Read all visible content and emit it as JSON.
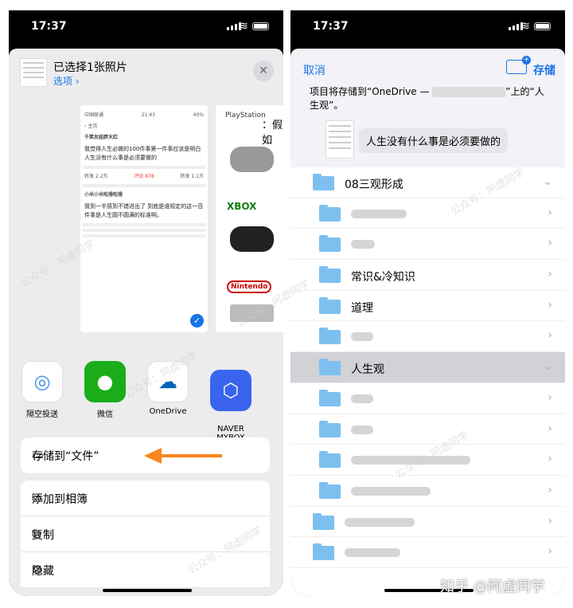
{
  "status": {
    "time": "17:37"
  },
  "share_sheet": {
    "title": "已选择1张照片",
    "options": "选项",
    "close": "✕",
    "preview": {
      "carrier": "中国联通",
      "time": "21:43",
      "battery": "40%",
      "back": "主页",
      "author": "千笑女娃胖大红",
      "post": "我觉得人生必做的100件事第一件事应该是明白人生没有什么事是必须要做的",
      "tabs": [
        "转发 2.2万",
        "评论 878",
        "转发 1.1万"
      ],
      "comment_user": "小米小米啦撸啦撸",
      "comment_text": "我到一半感到不错进出了 到底是谁规定的这一百件事是人生圆不圆满的标准啊。"
    },
    "preview2": {
      "title": "：假如",
      "logos": [
        "PlayStation",
        "XBOX",
        "Nintendo"
      ]
    },
    "apps": [
      {
        "label": "隔空投送",
        "icon": "airdrop-icon",
        "color": "#3a8ef0"
      },
      {
        "label": "微信",
        "icon": "wechat-icon",
        "color": "#1aad19"
      },
      {
        "label": "OneDrive",
        "icon": "onedrive-icon",
        "color": "#0364b8"
      },
      {
        "label": "NAVER\nMYBOX",
        "icon": "naver-mybox-icon",
        "color": "#3a64f0"
      }
    ],
    "actions": [
      {
        "label": "存储到“文件”",
        "icon": "folder-icon"
      },
      {
        "label": "添加到相簿",
        "icon": "add-album-icon"
      },
      {
        "label": "复制",
        "icon": "copy-icon"
      },
      {
        "label": "隐藏",
        "icon": "hide-eye-icon"
      }
    ]
  },
  "files": {
    "cancel": "取消",
    "save": "存储",
    "dest_prefix": "项目将存储到“OneDrive —",
    "dest_suffix": "”上的“人生观”。",
    "file_name": "人生没有什么事是必须要做的",
    "folders": [
      {
        "label": "08三观形成",
        "indent": 0,
        "expanded": true
      },
      {
        "label": "",
        "indent": 1,
        "blur": 70
      },
      {
        "label": "",
        "indent": 1,
        "blur": 30
      },
      {
        "label": "常识&冷知识",
        "indent": 1
      },
      {
        "label": "道理",
        "indent": 1
      },
      {
        "label": "",
        "indent": 1,
        "blur": 28
      },
      {
        "label": "人生观",
        "indent": 1,
        "expanded": true,
        "selected": true
      },
      {
        "label": "",
        "indent": 1,
        "blur": 28
      },
      {
        "label": "",
        "indent": 1,
        "blur": 28
      },
      {
        "label": "",
        "indent": 1,
        "blur": 150
      },
      {
        "label": "",
        "indent": 1,
        "blur": 100
      },
      {
        "label": "",
        "indent": 0,
        "blur": 88
      },
      {
        "label": "",
        "indent": 0,
        "blur": 70
      }
    ]
  },
  "watermark": "公众号：阿虚同学",
  "brand": "知乎 @阿虚同学"
}
